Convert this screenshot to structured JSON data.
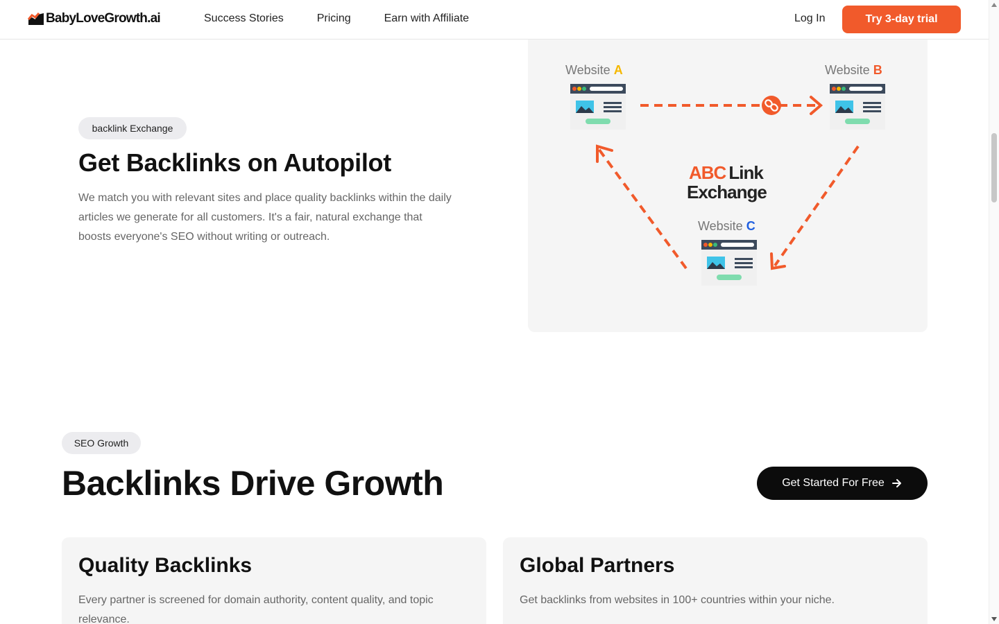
{
  "header": {
    "logo_text": "BabyLoveGrowth.ai",
    "nav": [
      "Success Stories",
      "Pricing",
      "Earn with Affiliate"
    ],
    "login_label": "Log In",
    "trial_label": "Try 3-day trial"
  },
  "section_exchange": {
    "badge": "backlink Exchange",
    "title": "Get Backlinks on Autopilot",
    "description": "We match you with relevant sites and place quality backlinks within the daily articles we generate for all customers. It's a fair, natural exchange that boosts everyone's SEO without writing or outreach."
  },
  "diagram": {
    "site_a_prefix": "Website ",
    "site_a_letter": "A",
    "site_b_prefix": "Website ",
    "site_b_letter": "B",
    "site_c_prefix": "Website ",
    "site_c_letter": "C",
    "center_brand": "ABC",
    "center_word1": "Link",
    "center_word2": "Exchange",
    "colors": {
      "accent": "#f15a2b",
      "a": "#f5b800",
      "b": "#f15a2b",
      "c": "#1f5fe0"
    }
  },
  "section_growth": {
    "badge": "SEO Growth",
    "title": "Backlinks Drive Growth",
    "cta_label": "Get Started For Free",
    "cards": [
      {
        "title": "Quality Backlinks",
        "text": "Every partner is screened for domain authority, content quality, and topic relevance."
      },
      {
        "title": "Global Partners",
        "text": "Get backlinks from websites in 100+ countries within your niche."
      }
    ]
  }
}
